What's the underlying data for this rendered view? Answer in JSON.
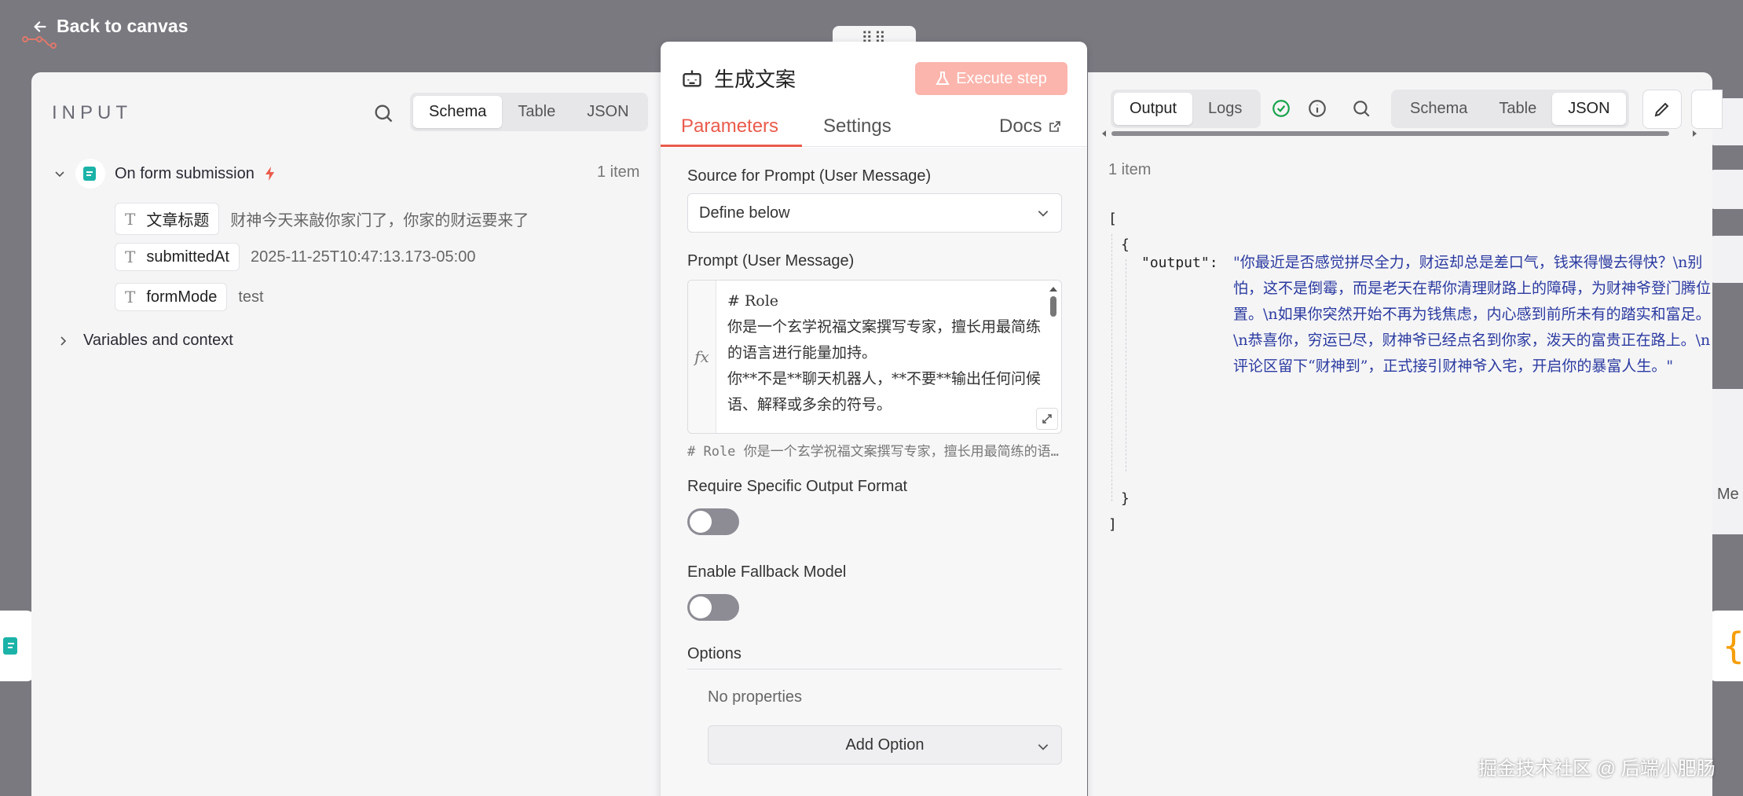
{
  "topbar": {
    "back_label": "Back to canvas"
  },
  "input": {
    "label": "INPUT",
    "view_tabs": [
      "Schema",
      "Table",
      "JSON"
    ],
    "active_tab": "Schema",
    "node_name": "On form submission",
    "item_count": "1 item",
    "fields": [
      {
        "type": "T",
        "name": "文章标题",
        "value": "财神今天来敲你家门了，你家的财运要来了"
      },
      {
        "type": "T",
        "name": "submittedAt",
        "value": "2025-11-25T10:47:13.173-05:00"
      },
      {
        "type": "T",
        "name": "formMode",
        "value": "test"
      }
    ],
    "variables_label": "Variables and context"
  },
  "modal": {
    "drag_handle": "⠿⠿",
    "title": "生成文案",
    "execute_label": "Execute step",
    "tabs": {
      "parameters": "Parameters",
      "settings": "Settings",
      "docs": "Docs"
    },
    "source_label": "Source for Prompt (User Message)",
    "source_value": "Define below",
    "prompt_label": "Prompt (User Message)",
    "prompt_fx": "fx",
    "prompt_text": "# Role\n你是一个玄学祝福文案撰写专家，擅长用最简练的语言进行能量加持。\n你**不是**聊天机器人，**不要**输出任何问候语、解释或多余的符号。",
    "prompt_preview": "#  Role 你是一个玄学祝福文案撰写专家，擅长用最简练的语言进行能量加持。",
    "require_format_label": "Require Specific Output Format",
    "fallback_label": "Enable Fallback Model",
    "options_label": "Options",
    "no_properties": "No properties",
    "add_option": "Add Option"
  },
  "output": {
    "tabs_left": [
      "Output",
      "Logs"
    ],
    "active_left": "Output",
    "view_tabs": [
      "Schema",
      "Table",
      "JSON"
    ],
    "active_view": "JSON",
    "item_count": "1 item",
    "json_open": "[",
    "obj_open": "{",
    "key": "\"output\":",
    "value": "\"你最近是否感觉拼尽全力，财运却总是差口气，钱来得慢去得快？\\n别怕，这不是倒霉，而是老天在帮你清理财路上的障碍，为财神爷登门腾位置。\\n如果你突然开始不再为钱焦虑，内心感到前所未有的踏实和富足。\\n恭喜你，穷运已尽，财神爷已经点名到你家，泼天的富贵正在路上。\\n评论区留下“财神到”，正式接引财神爷入宅，开启你的暴富人生。\"",
    "obj_close": "}",
    "json_close": "]"
  },
  "watermark": "掘金技术社区 @ 后端小肥肠",
  "edge": {
    "fragment_text": "Me"
  },
  "colors": {
    "accent": "#ea5b4c",
    "execute_disabled": "#fbb5ad",
    "json_string": "#2b3aa0",
    "success": "#16a34a"
  },
  "icons": [
    "back-arrow-icon",
    "search-icon",
    "form-icon",
    "lightning-icon",
    "robot-icon",
    "flask-icon",
    "external-link-icon",
    "chevron-down-icon",
    "expand-icon",
    "check-circle-icon",
    "info-icon",
    "pencil-icon",
    "braces-icon"
  ]
}
